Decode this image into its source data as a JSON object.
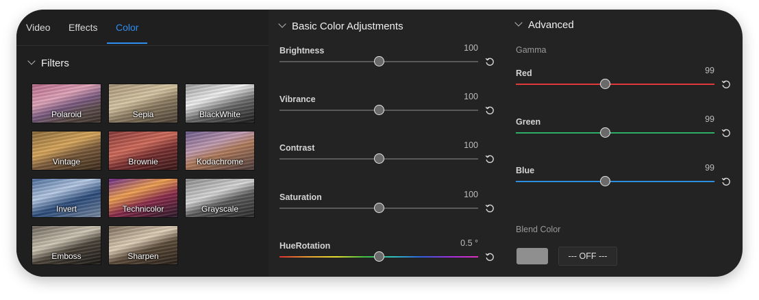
{
  "tabs": [
    "Video",
    "Effects",
    "Color"
  ],
  "filters_section": {
    "title": "Filters"
  },
  "filters": [
    "Polaroid",
    "Sepia",
    "BlackWhite",
    "Vintage",
    "Brownie",
    "Kodachrome",
    "Invert",
    "Technicolor",
    "Grayscale",
    "Emboss",
    "Sharpen"
  ],
  "basic": {
    "title": "Basic Color Adjustments",
    "sliders": [
      {
        "label": "Brightness",
        "value": "100",
        "level": 0.5
      },
      {
        "label": "Vibrance",
        "value": "100",
        "level": 0.5
      },
      {
        "label": "Contrast",
        "value": "100",
        "level": 0.5
      },
      {
        "label": "Saturation",
        "value": "100",
        "level": 0.5
      },
      {
        "label": "HueRotation",
        "value": "0.5 °",
        "level": 0.5
      }
    ]
  },
  "advanced": {
    "title": "Advanced",
    "gamma_label": "Gamma",
    "sliders": [
      {
        "label": "Red",
        "value": "99",
        "level": 0.45,
        "color": "#e03a3a"
      },
      {
        "label": "Green",
        "value": "99",
        "level": 0.45,
        "color": "#2fae6a"
      },
      {
        "label": "Blue",
        "value": "99",
        "level": 0.45,
        "color": "#2d8fdf"
      }
    ],
    "blend_label": "Blend Color",
    "blend_swatch_color": "#8f8f8f",
    "blend_off_label": "--- OFF ---"
  }
}
